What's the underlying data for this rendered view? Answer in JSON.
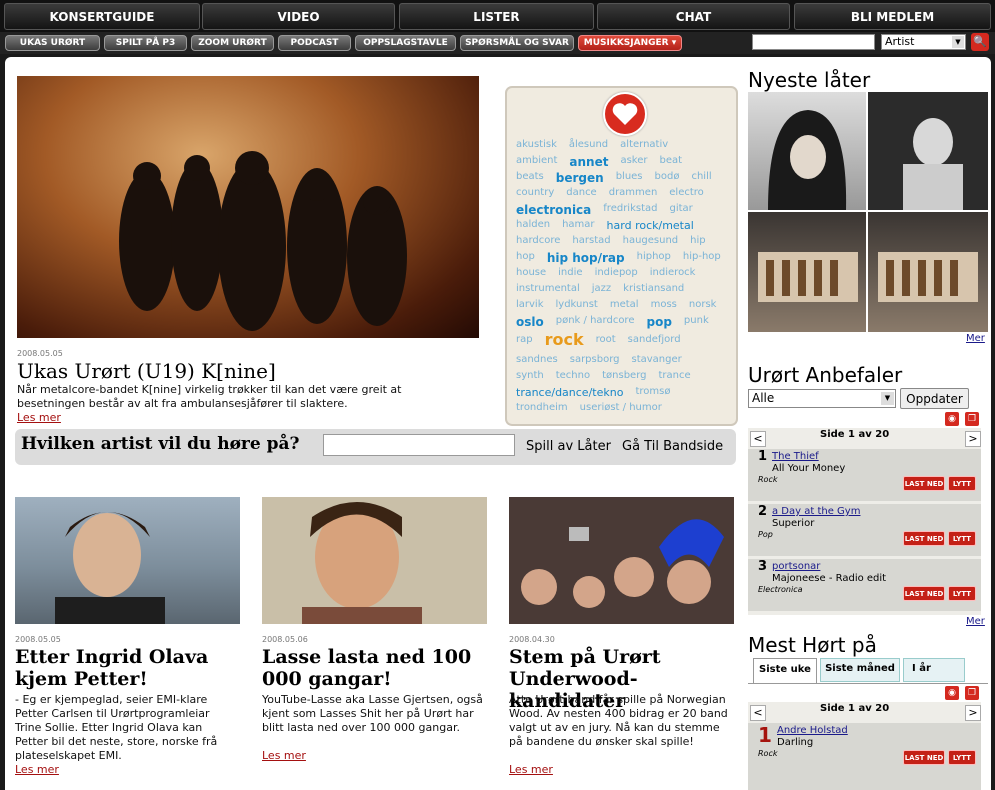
{
  "topnav": [
    "KONSERTGUIDE",
    "VIDEO",
    "LISTER",
    "CHAT",
    "BLI MEDLEM"
  ],
  "subnav": [
    "UKAS URØRT",
    "SPILT PÅ P3",
    "ZOOM URØRT",
    "PODCAST",
    "OPPSLAGSTAVLE",
    "SPØRSMÅL OG SVAR",
    "MUSIKKSJANGER ▾"
  ],
  "search": {
    "select_value": "Artist",
    "button": "🔍"
  },
  "feature": {
    "date": "2008.05.05",
    "title": "Ukas Urørt (U19) K[nine]",
    "text": "Når metalcore-bandet K[nine] virkelig trøkker til kan det være greit at besetningen består av alt fra ambulansesjåfører til slaktere.",
    "more": "Les mer"
  },
  "cloud": [
    [
      "akustisk",
      ""
    ],
    [
      "ålesund",
      ""
    ],
    [
      "alternativ",
      ""
    ],
    [
      "ambient",
      ""
    ],
    [
      "annet",
      "b"
    ],
    [
      "asker",
      ""
    ],
    [
      "beat",
      ""
    ],
    [
      "beats",
      ""
    ],
    [
      "bergen",
      "b"
    ],
    [
      "blues",
      ""
    ],
    [
      "bodø",
      ""
    ],
    [
      "chill",
      ""
    ],
    [
      "country",
      ""
    ],
    [
      "dance",
      ""
    ],
    [
      "drammen",
      ""
    ],
    [
      "electro",
      ""
    ],
    [
      "electronica",
      "b"
    ],
    [
      "fredrikstad",
      ""
    ],
    [
      "gitar",
      ""
    ],
    [
      "halden",
      ""
    ],
    [
      "hamar",
      ""
    ],
    [
      "hard rock/metal",
      "b2"
    ],
    [
      "hardcore",
      ""
    ],
    [
      "harstad",
      ""
    ],
    [
      "haugesund",
      ""
    ],
    [
      "hip",
      ""
    ],
    [
      "hop",
      ""
    ],
    [
      "hip hop/rap",
      "b"
    ],
    [
      "hiphop",
      ""
    ],
    [
      "hip-hop",
      ""
    ],
    [
      "house",
      ""
    ],
    [
      "indie",
      ""
    ],
    [
      "indiepop",
      ""
    ],
    [
      "indierock",
      ""
    ],
    [
      "instrumental",
      ""
    ],
    [
      "jazz",
      ""
    ],
    [
      "kristiansand",
      ""
    ],
    [
      "larvik",
      ""
    ],
    [
      "lydkunst",
      ""
    ],
    [
      "metal",
      ""
    ],
    [
      "moss",
      ""
    ],
    [
      "norsk",
      ""
    ],
    [
      "oslo",
      "b"
    ],
    [
      "pønk / hardcore",
      ""
    ],
    [
      "pop",
      "b"
    ],
    [
      "punk",
      ""
    ],
    [
      "rap",
      ""
    ],
    [
      "rock",
      "big"
    ],
    [
      "root",
      ""
    ],
    [
      "sandefjord",
      ""
    ],
    [
      "sandnes",
      ""
    ],
    [
      "sarpsborg",
      ""
    ],
    [
      "stavanger",
      ""
    ],
    [
      "synth",
      ""
    ],
    [
      "techno",
      ""
    ],
    [
      "tønsberg",
      ""
    ],
    [
      "trance",
      ""
    ],
    [
      "trance/dance/tekno",
      "b2"
    ],
    [
      "tromsø",
      ""
    ],
    [
      "trondheim",
      ""
    ],
    [
      "useriøst / humor",
      ""
    ]
  ],
  "ask": {
    "question": "Hvilken artist vil du høre på?",
    "play": "Spill av Låter",
    "goto": "Gå Til Bandside"
  },
  "articles": [
    {
      "date": "2008.05.05",
      "title": "Etter Ingrid Olava kjem Petter!",
      "text": "- Eg er kjempeglad, seier EMI-klare Petter Carlsen til Urørtprogramleiar Trine Sollie. Etter Ingrid Olava kan Petter bil det neste, store, norske frå plateselskapet EMI.",
      "more": "Les mer"
    },
    {
      "date": "2008.05.06",
      "title": "Lasse lasta ned 100 000 gangar!",
      "text": "YouTube-Lasse aka Lasse Gjertsen, også kjent som Lasses Shit her på Urørt har blitt lasta ned over 100 000 gangar.",
      "more": "Les mer"
    },
    {
      "date": "2008.04.30",
      "title": "Stem på Urørt Underwood-kandidater",
      "text": "Åtte Urørt-band får spille på Norwegian Wood. Av nesten 400 bidrag er 20 band valgt ut av en jury. Nå kan du stemme på bandene du ønsker skal spille!",
      "more": "Les mer"
    }
  ],
  "nyeste": {
    "title": "Nyeste låter",
    "more": "Mer"
  },
  "anbefaler": {
    "title": "Urørt Anbefaler",
    "select": "Alle",
    "update": "Oppdater",
    "page": "Side 1 av 20",
    "more": "Mer",
    "rows": [
      {
        "n": "1",
        "artist": "The Thief",
        "song": "All Your Money",
        "genre": "Rock"
      },
      {
        "n": "2",
        "artist": "a Day at the Gym",
        "song": "Superior",
        "genre": "Pop"
      },
      {
        "n": "3",
        "artist": "portsonar",
        "song": "Majoneese - Radio edit",
        "genre": "Electronica"
      }
    ],
    "btn_last": "LAST NED",
    "btn_lytt": "LYTT"
  },
  "mest": {
    "title": "Mest Hørt på",
    "tabs": [
      "Siste uke",
      "Siste måned",
      "I år"
    ],
    "page": "Side 1 av 20",
    "rows": [
      {
        "n": "1",
        "artist": "Andre Holstad",
        "song": "Darling",
        "genre": "Rock"
      }
    ]
  }
}
